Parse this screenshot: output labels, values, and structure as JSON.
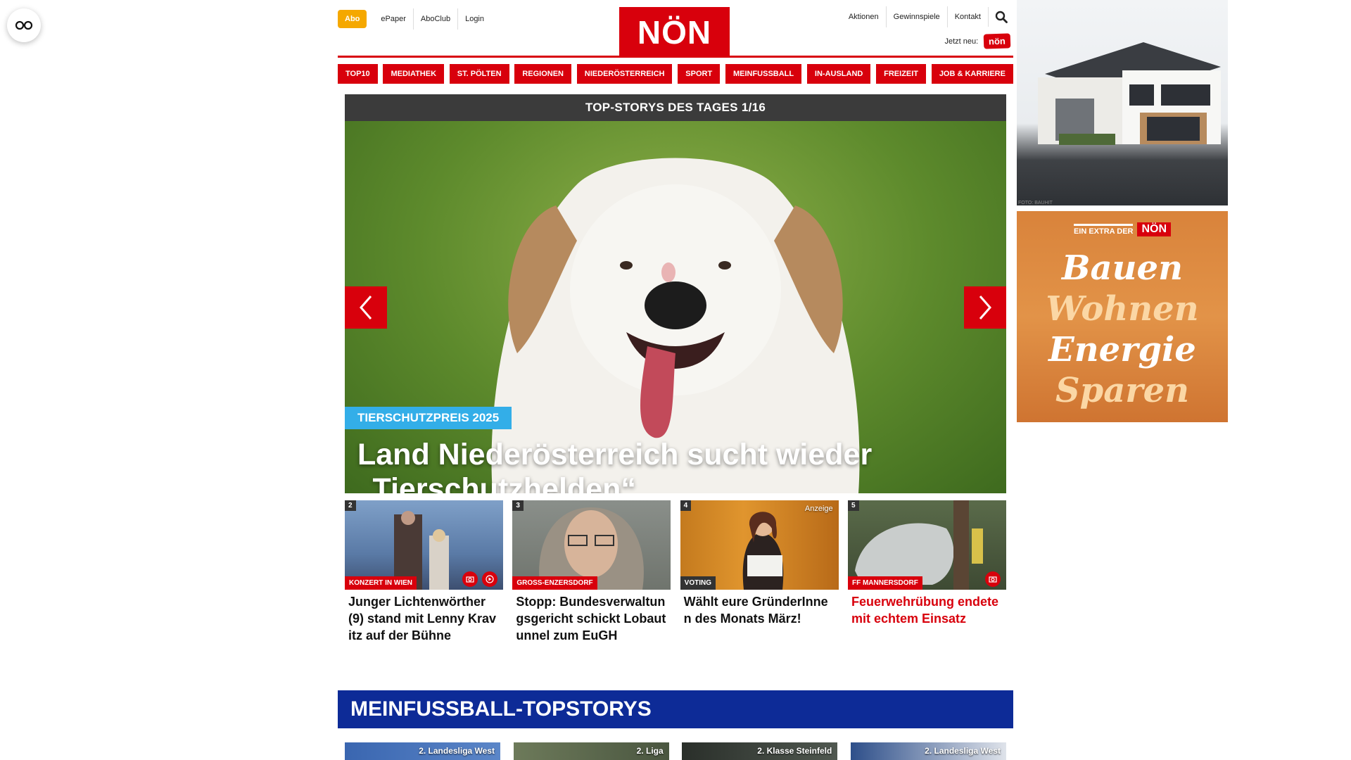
{
  "header": {
    "abo_label": "Abo",
    "left_links": [
      "ePaper",
      "AboClub",
      "Login"
    ],
    "logo_text": "NÖN",
    "right_links": [
      "Aktionen",
      "Gewinnspiele",
      "Kontakt"
    ],
    "jetzt_label": "Jetzt neu:",
    "jetzt_badge": "nön"
  },
  "nav": {
    "items": [
      "TOP10",
      "MEDIATHEK",
      "ST. PÖLTEN",
      "REGIONEN",
      "NIEDERÖSTERREICH",
      "SPORT",
      "MEINFUSSBALL",
      "IN-AUSLAND",
      "FREIZEIT",
      "JOB & KARRIERE"
    ]
  },
  "hero": {
    "bar_label": "TOP-STORYS DES TAGES 1/16",
    "tag": "TIERSCHUTZPREIS 2025",
    "title": "Land Niederösterreich sucht wieder „Tierschutzhelden“"
  },
  "cards": [
    {
      "num": "2",
      "tag": "KONZERT IN WIEN",
      "title": "Junger Lichtenwörther (9) stand mit Lenny Kravitz auf der Bühne",
      "icons": [
        "camera-icon",
        "play-icon"
      ]
    },
    {
      "num": "3",
      "tag": "GROSS-ENZERSDORF",
      "title": "Stopp: Bundesverwaltungsgericht schickt Lobautunnel zum EuGH",
      "icons": []
    },
    {
      "num": "4",
      "tag": "VOTING",
      "anzeige": "Anzeige",
      "title": "Wählt eure GründerInnen des Monats März!",
      "icons": []
    },
    {
      "num": "5",
      "tag": "FF MANNERSDORF",
      "title": "Feuerwehrübung endete mit echtem Einsatz",
      "icons": [
        "camera-icon"
      ]
    }
  ],
  "section": {
    "title": "MEINFUSSBALL-TOPSTORYS",
    "thumbs": [
      "2. Landesliga West",
      "2. Liga",
      "2. Klasse Steinfeld",
      "2. Landesliga West"
    ]
  },
  "ads": {
    "ad1_credit": "FOTO: BAUHIT",
    "ad2_small": "EIN EXTRA DER",
    "ad2_badge": "NÖN",
    "ad2_words": [
      "Bauen",
      "Wohnen",
      "Energie",
      "Sparen"
    ]
  },
  "colors": {
    "brand_red": "#d8000c",
    "abo_yellow": "#f5a800",
    "tag_blue": "#33aee8",
    "section_blue": "#0d2b97"
  }
}
